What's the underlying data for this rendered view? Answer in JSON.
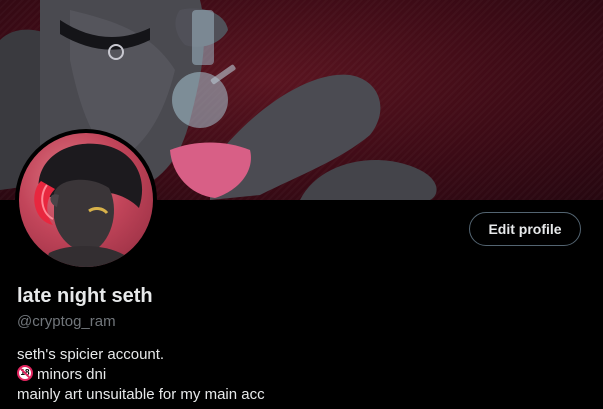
{
  "profile": {
    "display_name": "late night seth",
    "handle": "@cryptog_ram",
    "edit_label": "Edit profile",
    "bio": {
      "line1": "seth's spicier account.",
      "line2_badge": "18",
      "line2": "minors dni",
      "line3": "mainly art unsuitable for my main acc"
    }
  },
  "images": {
    "banner": "header-banner-image",
    "avatar": "profile-avatar-image",
    "age_icon": "no-under-18-icon"
  },
  "colors": {
    "background": "#000000",
    "text_primary": "#e7e9ea",
    "text_secondary": "#71767b",
    "button_border": "#536471",
    "banner_base": "#3d0b16",
    "avatar_base": "#c2455a"
  }
}
